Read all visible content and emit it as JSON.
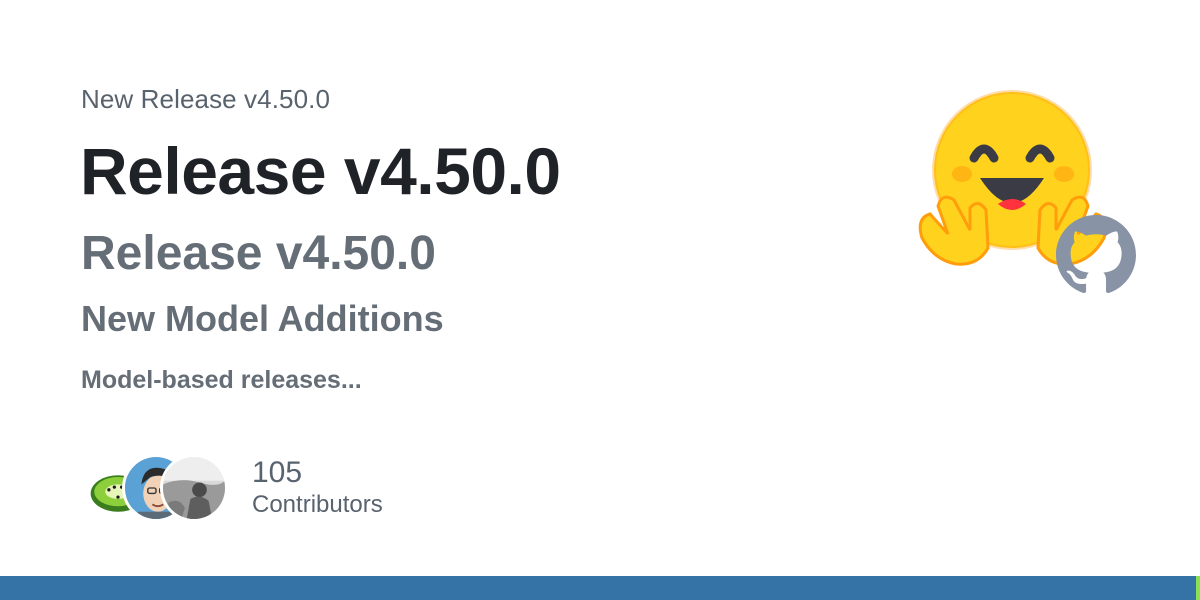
{
  "card": {
    "overline": "New Release v4.50.0",
    "title": "Release v4.50.0",
    "subtitle": "Release v4.50.0",
    "heading": "New Model Additions",
    "summary": "Model-based releases..."
  },
  "contributors": {
    "count": "105",
    "label": "Contributors",
    "avatars": [
      "kiwi-avatar",
      "cartoon-man-avatar",
      "photo-avatar"
    ]
  },
  "logos": [
    "hugging-face-logo",
    "github-mark-icon"
  ],
  "colors": {
    "title": "#1f2328",
    "muted": "#656d76",
    "language_bar": "#3572a5",
    "language_bar_accent": "#89e051",
    "hf_yellow": "#FFD21E"
  }
}
